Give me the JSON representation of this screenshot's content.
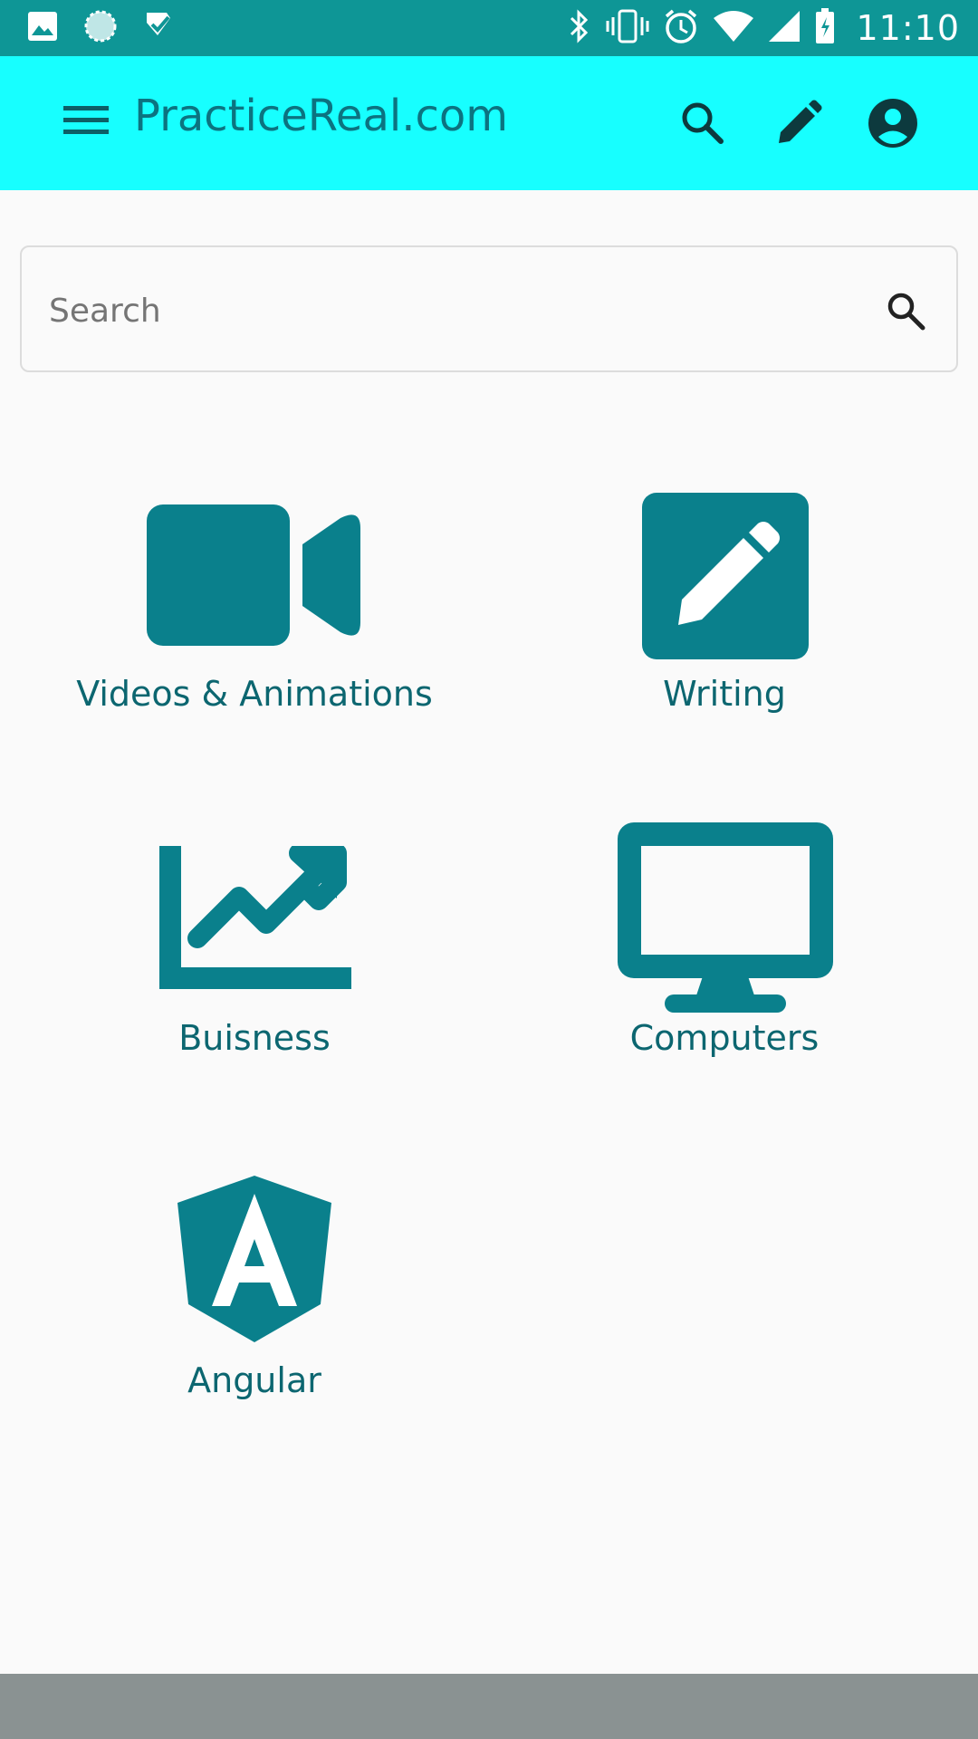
{
  "status_bar": {
    "time": "11:10",
    "left_icons": [
      "image-icon",
      "sync-icon",
      "check-icon"
    ],
    "right_icons": [
      "bluetooth-icon",
      "vibrate-icon",
      "alarm-icon",
      "wifi-icon",
      "signal-icon",
      "battery-icon"
    ]
  },
  "appbar": {
    "title": "PracticeReal.com",
    "icons": [
      "menu-icon",
      "search-icon",
      "pencil-icon",
      "account-icon"
    ]
  },
  "search": {
    "placeholder": "Search",
    "value": ""
  },
  "categories": [
    {
      "label": "Videos & Animations",
      "icon": "videocam-icon"
    },
    {
      "label": "Writing",
      "icon": "edit-box-icon"
    },
    {
      "label": "Buisness",
      "icon": "trending-chart-icon"
    },
    {
      "label": "Computers",
      "icon": "desktop-monitor-icon"
    },
    {
      "label": "Angular",
      "icon": "angular-logo-icon"
    }
  ],
  "colors": {
    "status_bar": "#0e9696",
    "appbar": "#17ffff",
    "accent": "#0a808c",
    "label": "#0c6670",
    "bottom_bar": "#8a9292"
  }
}
